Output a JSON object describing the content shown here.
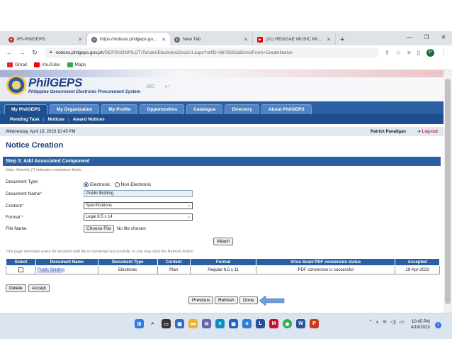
{
  "browser": {
    "tabs": [
      {
        "label": "PS-PhilGEPS",
        "active": false,
        "icon_color": "#c0392b"
      },
      {
        "label": "https://notices.philgeps.gov.ph/",
        "active": true,
        "icon_color": "#5f6368"
      },
      {
        "label": "New Tab",
        "active": false,
        "icon_color": "#5f6368"
      },
      {
        "label": "(31) REGGAE MUSIC MIX 2023 -",
        "active": false,
        "icon_color": "#e00000"
      }
    ],
    "new_tab_label": "+",
    "window_controls": {
      "minimize": "—",
      "restore": "❐",
      "close": "✕"
    },
    "url_host": "notices.philgeps.gov.ph",
    "url_path": "/GEPSNONPILOT/Tender/ElectronicDocsUI.aspx?refID=9679591&DirectFrom=CreateNotice",
    "profile_initial": "P",
    "bookmarks": [
      {
        "label": "Gmail",
        "icon_color": "#d93025"
      },
      {
        "label": "YouTube",
        "icon_color": "#ff0000"
      },
      {
        "label": "Maps",
        "icon_color": "#34a853"
      }
    ]
  },
  "site": {
    "logo_title": "PhilGEPS",
    "logo_subtitle": "Philippine Government Electronic Procurement System",
    "bid_mark": "BID",
    "nav_tabs": [
      "My PhilGEPS",
      "My Organization",
      "My Profile",
      "Opportunities",
      "Catalogue",
      "Directory",
      "About PhilGEPS"
    ],
    "active_tab": "My PhilGEPS",
    "subnav": [
      "Pending Task",
      "Notices",
      "Award Notices"
    ],
    "date_time": "Wednesday, April 19, 2023 10:45 PM",
    "user_name": "Patrick Panaligan",
    "logout_label": "Log-out"
  },
  "form": {
    "page_title": "Notice Creation",
    "step_title": "Step 3: Add Associated Component",
    "note": "Note: Asterisk (*) indicates mandatory fields",
    "document_type_label": "Document Type",
    "document_type_options": [
      "Electronic",
      "Non-Electronic"
    ],
    "document_type_selected": "Electronic",
    "document_name_label": "Document Name",
    "document_name_value": "Public Bidding",
    "content_label": "Content",
    "content_value": "Specifications",
    "format_label": "Format",
    "format_value": "Legal 8.5 x 14",
    "file_name_label": "File Name",
    "choose_file_label": "Choose File",
    "file_status": "No file chosen",
    "attach_label": "Attach",
    "refresh_note": "This page refreshes every 60 seconds until file is converted successfully, or you may click the Refresh button"
  },
  "table": {
    "headers": [
      "Select",
      "Document Name",
      "Document Type",
      "Content",
      "Format",
      "Virus Scan/ PDF conversion status",
      "Accepted"
    ],
    "rows": [
      [
        "",
        "Public Bidding",
        "Electronic",
        "Plan",
        "Regular 8.5 x 11",
        "PDF conversion is successful",
        "19-Apr-2023"
      ]
    ]
  },
  "actions": {
    "delete_label": "Delete",
    "accept_label": "Accept",
    "previous_label": "Previous",
    "refresh_label": "Refresh",
    "done_label": "Done"
  },
  "taskbar": {
    "time": "10:45 PM",
    "date": "4/19/2023",
    "notification_count": "2"
  },
  "colors": {
    "nav_blue": "#2a5fa3",
    "nav_dark": "#1e4e8e",
    "title_blue": "#1d3f7a",
    "logout_red": "#c0262d",
    "annotation_arrow": "#6d9fd6"
  }
}
